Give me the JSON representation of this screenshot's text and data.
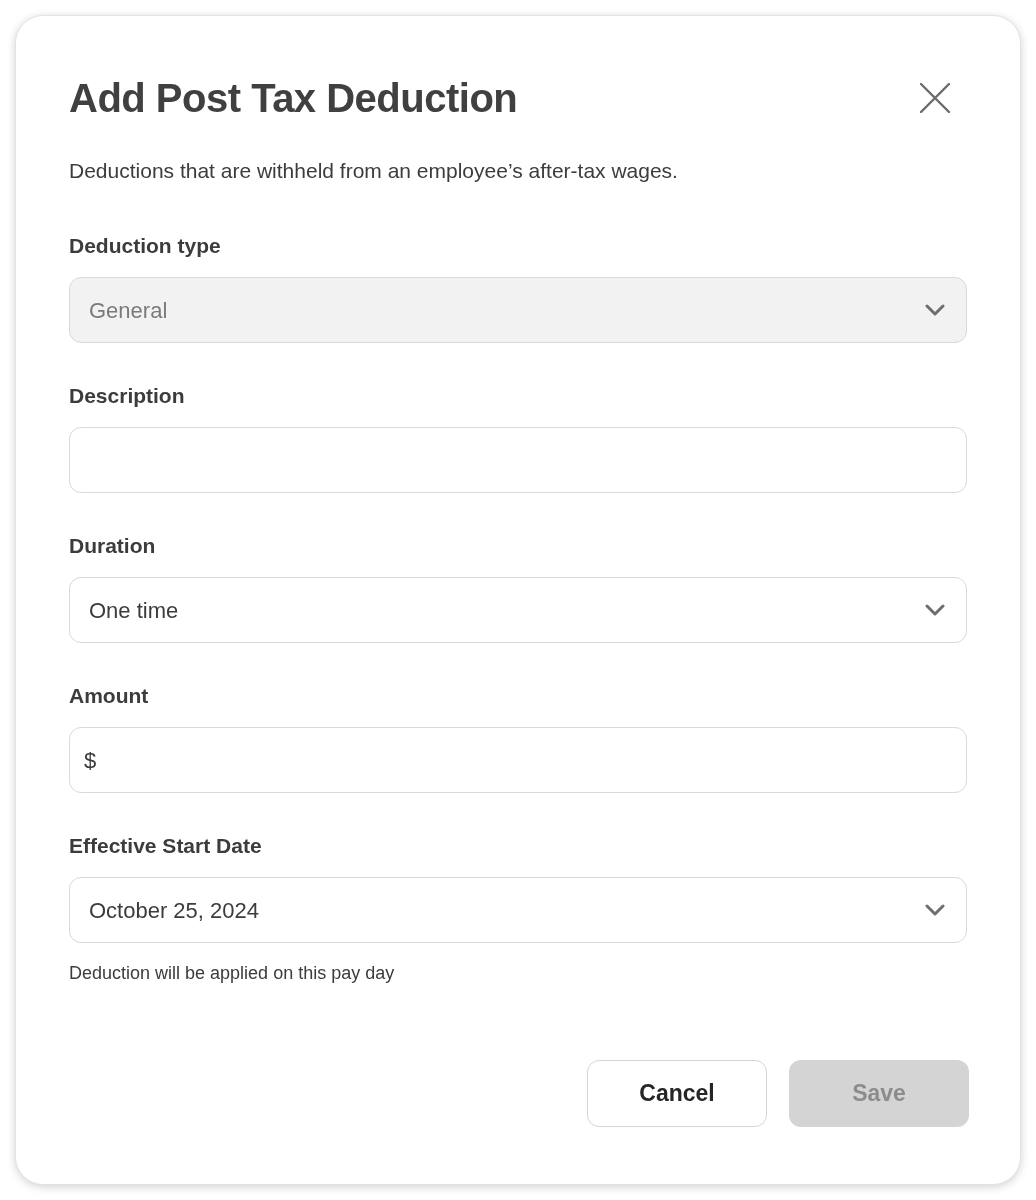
{
  "dialog": {
    "title": "Add Post Tax Deduction",
    "description": "Deductions that are withheld from an employee’s after-tax wages.",
    "fields": [
      {
        "kind": "select",
        "label": "Deduction type",
        "value": "General",
        "disabled": true
      },
      {
        "kind": "text",
        "label": "Description",
        "disabled": false
      },
      {
        "kind": "select",
        "label": "Duration",
        "value": "One time",
        "disabled": false
      },
      {
        "kind": "currency",
        "label": "Amount",
        "prefix": "$",
        "disabled": false
      },
      {
        "kind": "select",
        "label": "Effective Start Date",
        "value": "October 25, 2024",
        "disabled": false,
        "helper": "Deduction will be applied on this pay day"
      }
    ],
    "buttons": [
      {
        "kind": "secondary",
        "label": "Cancel",
        "disabled": false
      },
      {
        "kind": "primary",
        "label": "Save",
        "disabled": true
      }
    ]
  }
}
